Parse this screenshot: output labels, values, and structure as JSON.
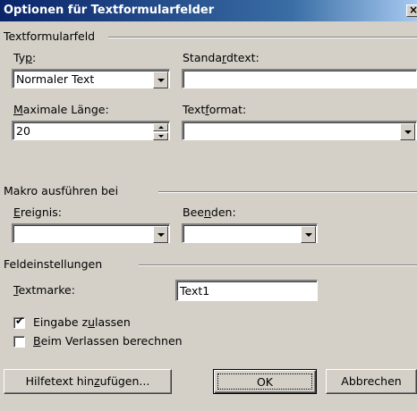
{
  "window": {
    "title": "Optionen für Textformularfelder",
    "close_glyph": "×"
  },
  "group_textformularfeld": {
    "title": "Textformularfeld",
    "typ_label": "Typ:",
    "typ_value": "Normaler Text",
    "standardtext_label": "Standardtext:",
    "standardtext_value": "",
    "maxlaenge_label": "Maximale Länge:",
    "maxlaenge_value": "20",
    "textformat_label": "Textformat:",
    "textformat_value": ""
  },
  "group_makro": {
    "title": "Makro ausführen bei",
    "ereignis_label": "Ereignis:",
    "ereignis_value": "",
    "beenden_label": "Beenden:",
    "beenden_value": ""
  },
  "group_feld": {
    "title": "Feldeinstellungen",
    "textmarke_label": "Textmarke:",
    "textmarke_value": "Text1",
    "eingabe_label": "Eingabe zulassen",
    "eingabe_checked": true,
    "verlassen_label": "Beim Verlassen berechnen",
    "verlassen_checked": false
  },
  "buttons": {
    "help": "Hilfetext hinzufügen...",
    "ok": "OK",
    "cancel": "Abbrechen"
  },
  "colors": {
    "face": "#d4d0c8",
    "title_start": "#0a246a",
    "title_end": "#a6caf0"
  }
}
